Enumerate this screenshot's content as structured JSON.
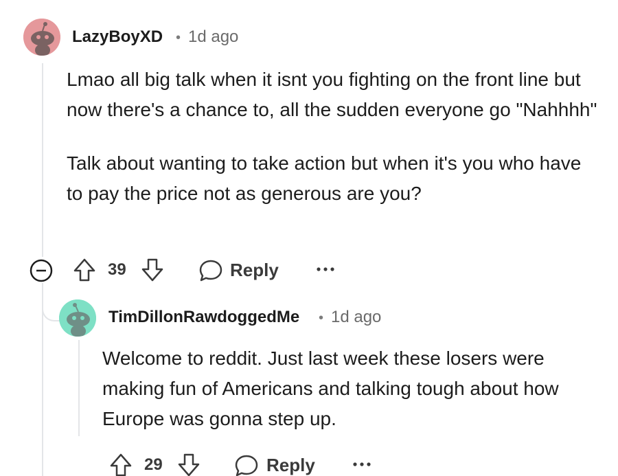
{
  "comments": [
    {
      "username": "LazyBoyXD",
      "separator": "•",
      "timestamp": "1d ago",
      "avatar_icon": "snoo-avatar-icon",
      "avatar_color": "#e5989b",
      "body": [
        "Lmao all big talk when it isnt you fighting on the front line but now there's a chance to, all the sudden everyone go \"Nahhhh\"",
        "Talk about wanting to take action but when it's you who have to pay the price not as generous are you?"
      ],
      "actions": {
        "collapse_icon": "collapse-minus-icon",
        "upvote_icon": "upvote-arrow-icon",
        "votes": "39",
        "downvote_icon": "downvote-arrow-icon",
        "reply_icon": "chat-bubble-icon",
        "reply_label": "Reply",
        "more_icon": "more-dots-icon"
      }
    },
    {
      "username": "TimDillonRawdoggedMe",
      "separator": "•",
      "timestamp": "1d ago",
      "avatar_icon": "snoo-avatar-icon",
      "avatar_color": "#7ee0c5",
      "body": [
        "Welcome to reddit. Just last week these losers were making fun of Americans and talking tough about how Europe was gonna step up."
      ],
      "actions": {
        "upvote_icon": "upvote-arrow-icon",
        "votes": "29",
        "downvote_icon": "downvote-arrow-icon",
        "reply_icon": "chat-bubble-icon",
        "reply_label": "Reply",
        "more_icon": "more-dots-icon"
      }
    }
  ]
}
